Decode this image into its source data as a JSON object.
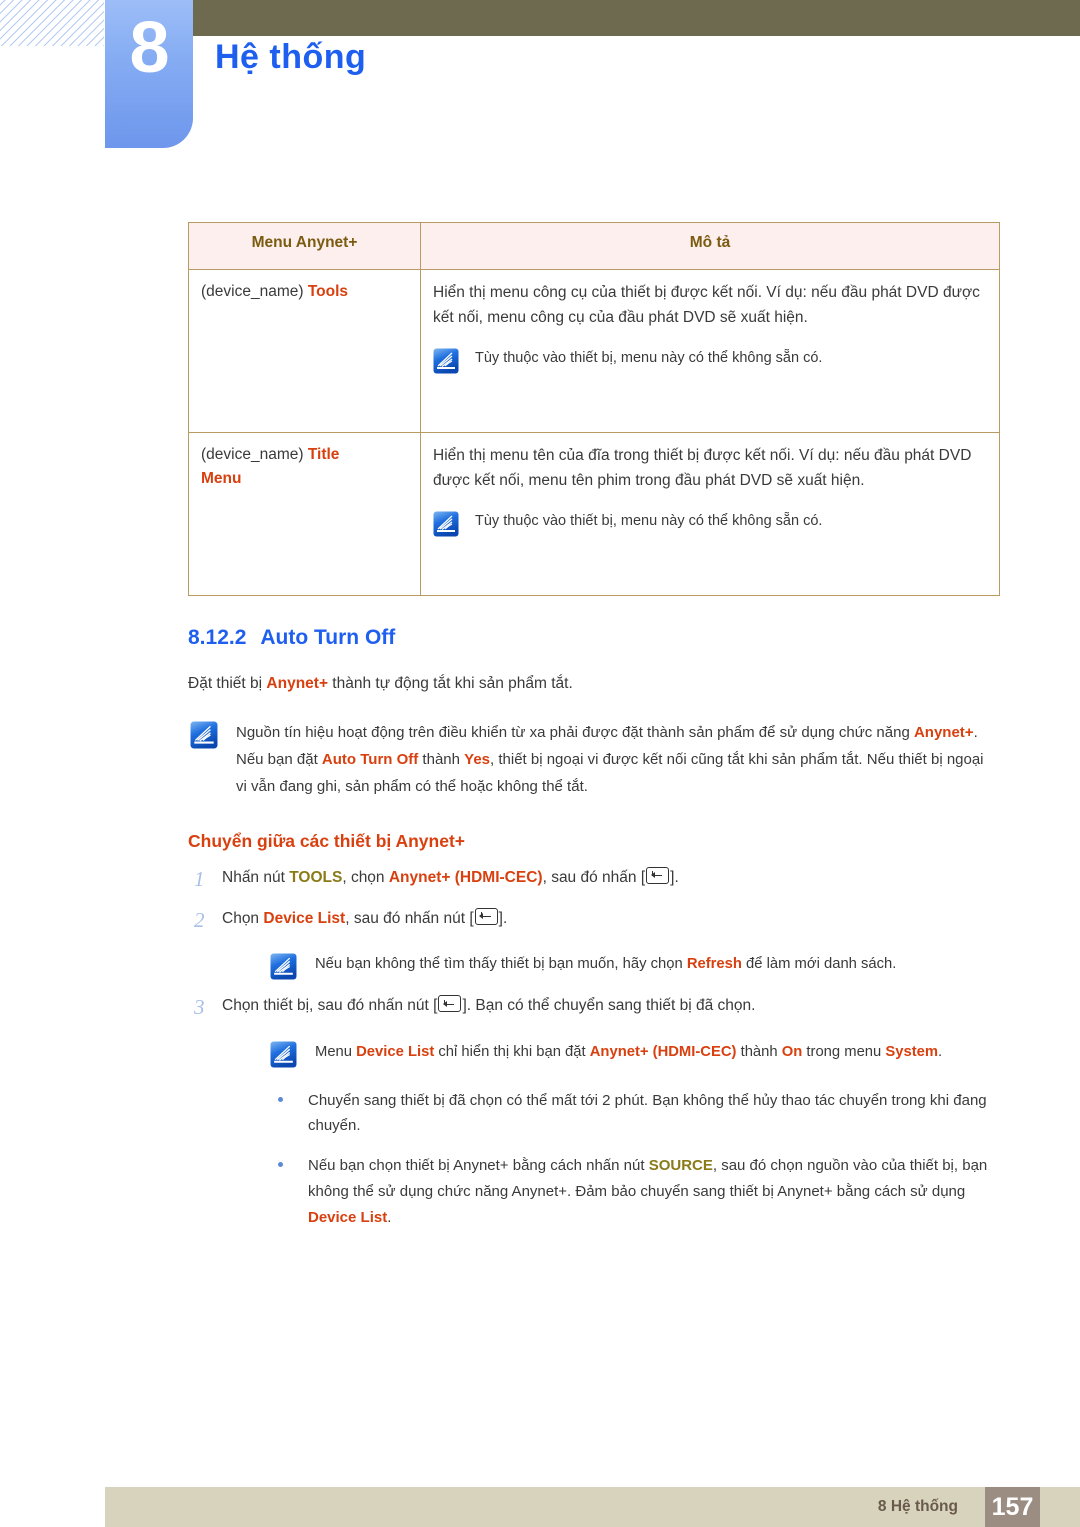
{
  "header": {
    "chapter_number": "8",
    "chapter_title": "Hệ thống"
  },
  "table": {
    "headers": [
      "Menu Anynet+",
      "Mô tả"
    ],
    "rows": [
      {
        "menu_plain": "(device_name) ",
        "menu_highlight": "Tools",
        "menu_highlight2": "",
        "desc": "Hiển thị menu công cụ của thiết bị được kết nối. Ví dụ: nếu đầu phát DVD được kết nối, menu công cụ của đầu phát DVD sẽ xuất hiện.",
        "note": "Tùy thuộc vào thiết bị, menu này có thể không sẵn có."
      },
      {
        "menu_plain": "(device_name) ",
        "menu_highlight": "Title",
        "menu_highlight2": "Menu",
        "desc": "Hiển thị menu tên của đĩa trong thiết bị được kết nối. Ví dụ: nếu đầu phát DVD được kết nối, menu tên phim trong đầu phát DVD sẽ xuất hiện.",
        "note": "Tùy thuộc vào thiết bị, menu này có thể không sẵn có."
      }
    ]
  },
  "section": {
    "number": "8.12.2",
    "title": "Auto Turn Off",
    "intro": {
      "p1": "Đặt thiết bị ",
      "kw1": "Anynet+",
      "p2": " thành tự động tắt khi sản phẩm tắt."
    },
    "note": {
      "t1": "Nguồn tín hiệu hoạt động trên điều khiển từ xa phải được đặt thành sản phẩm để sử dụng chức năng ",
      "kw1": "Anynet+",
      "t2": ". Nếu bạn đặt ",
      "kw2": "Auto Turn Off",
      "t3": " thành ",
      "kw3": "Yes",
      "t4": ", thiết bị ngoại vi được kết nối cũng tắt khi sản phẩm tắt. Nếu thiết bị ngoại vi vẫn đang ghi, sản phẩm có thể hoặc không thể tắt."
    }
  },
  "switching": {
    "heading": "Chuyển giữa các thiết bị Anynet+",
    "steps": [
      {
        "number": "1",
        "t1": "Nhấn nút ",
        "kw_gold": "TOOLS",
        "t2": ", chọn ",
        "kw_orange": "Anynet+ (HDMI-CEC)",
        "t3": ", sau đó nhấn [",
        "t4": "]."
      },
      {
        "number": "2",
        "t1": "Chọn ",
        "kw_orange": "Device List",
        "t2": ", sau đó nhấn nút [",
        "t3": "]."
      },
      {
        "number": "3",
        "t1": "Chọn thiết bị, sau đó nhấn nút [",
        "t2": "]. Bạn có thể chuyển sang thiết bị đã chọn."
      }
    ],
    "note_after_step2": {
      "t1": "Nếu bạn không thể tìm thấy thiết bị bạn muốn, hãy chọn ",
      "kw1": "Refresh",
      "t2": " để làm mới danh sách."
    },
    "note_after_step3": {
      "t1": "Menu ",
      "kw1": "Device List",
      "t2": " chỉ hiển thị khi bạn đặt ",
      "kw2": "Anynet+ (HDMI-CEC)",
      "t3": " thành ",
      "kw3": "On",
      "t4": " trong menu ",
      "kw4": "System",
      "t5": "."
    },
    "bullets": [
      {
        "t1": "Chuyển sang thiết bị đã chọn có thể mất tới 2 phút. Bạn không thể hủy thao tác chuyển trong khi đang chuyển."
      },
      {
        "t1": "Nếu bạn chọn thiết bị Anynet+ bằng cách nhấn nút ",
        "kw_gold": "SOURCE",
        "t2": ", sau đó chọn nguồn vào của thiết bị, bạn không thể sử dụng chức năng Anynet+. Đảm bảo chuyển sang thiết bị Anynet+ bằng cách sử dụng ",
        "kw_orange": "Device List",
        "t3": "."
      }
    ]
  },
  "footer": {
    "label": "8 Hệ thống",
    "page": "157"
  },
  "colors": {
    "accent_blue": "#1f5ff0",
    "accent_orange": "#d9400f",
    "accent_gold": "#8a7a18",
    "olive_bar": "#6e6a50",
    "footer_bar": "#d8d3bd",
    "footer_page_box": "#9c8d82",
    "table_header_bg": "#fcefee",
    "table_border": "#b89a63"
  }
}
